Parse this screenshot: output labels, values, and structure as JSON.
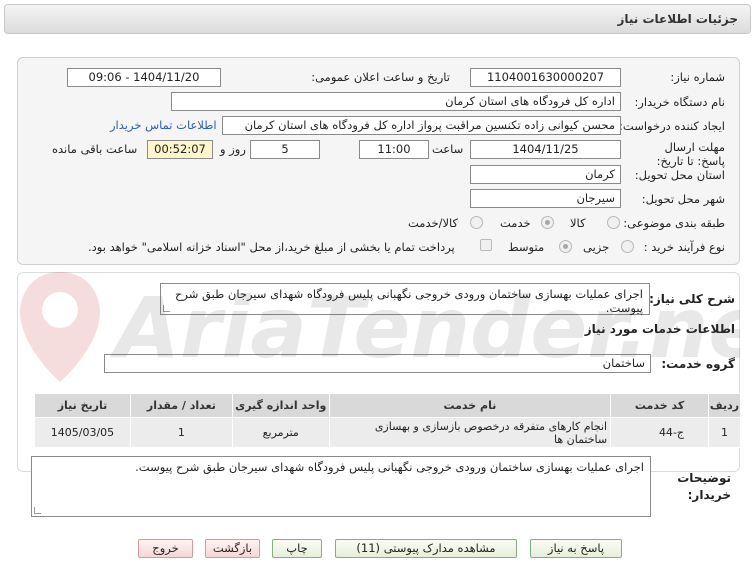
{
  "header": {
    "title": "جزئیات اطلاعات نیاز"
  },
  "form": {
    "need_number_label": "شماره نیاز:",
    "need_number": "1104001630000207",
    "announce_label": "تاریخ و ساعت اعلان عمومی:",
    "announce_value": "1404/11/20 - 09:06",
    "buyer_org_label": "نام دستگاه خریدار:",
    "buyer_org": "اداره کل فرودگاه های استان کرمان",
    "requester_label": "ایجاد کننده درخواست:",
    "requester": "محسن کیوانی زاده تکنسین مراقبت پرواز اداره کل فرودگاه های استان کرمان",
    "contact_link": "اطلاعات تماس خریدار",
    "deadline_label": "مهلت ارسال پاسخ: تا تاریخ:",
    "deadline_date": "1404/11/25",
    "hour_label": "ساعت",
    "deadline_hour": "11:00",
    "days_value": "5",
    "days_label": "روز و",
    "remaining_time": "00:52:07",
    "remaining_label": "ساعت باقی مانده",
    "province_label": "استان محل تحویل:",
    "province": "کرمان",
    "city_label": "شهر محل تحویل:",
    "city": "سیرجان",
    "category_label": "طبقه بندی موضوعی:",
    "category_options": [
      "کالا",
      "خدمت",
      "کالا/خدمت"
    ],
    "process_label": "نوع فرآیند خرید :",
    "process_options": [
      "جزیی",
      "متوسط"
    ],
    "payment_note": "پرداخت تمام یا بخشی از مبلغ خرید،از محل \"اسناد خزانه اسلامی\" خواهد بود."
  },
  "description": {
    "label": "شرح کلی نیاز:",
    "text": "اجرای عملیات بهسازی ساختمان ورودی خروجی نگهبانی پلیس فرودگاه شهدای سیرجان طبق شرح پیوست."
  },
  "services": {
    "section_title": "اطلاعات خدمات مورد نیاز",
    "group_label": "گروه خدمت:",
    "group_value": "ساختمان",
    "columns": [
      "ردیف",
      "کد خدمت",
      "نام خدمت",
      "واحد اندازه گیری",
      "تعداد / مقدار",
      "تاریخ نیاز"
    ],
    "rows": [
      [
        "1",
        "ج-44",
        "انجام کارهای متفرقه درخصوص بازسازی و بهسازی ساختمان ها",
        "مترمربع",
        "1",
        "1405/03/05"
      ]
    ]
  },
  "buyer_notes": {
    "label": "توضیحات خریدار:",
    "text": "اجرای عملیات بهسازی ساختمان ورودی خروجی نگهبانی پلیس فرودگاه شهدای سیرجان طبق شرح پیوست."
  },
  "buttons": {
    "reply": "پاسخ به نیاز",
    "attachments": "مشاهده مدارک پیوستی (11)",
    "print": "چاپ",
    "back": "بازگشت",
    "exit": "خروج"
  },
  "watermark_text": "AriaTender.net"
}
